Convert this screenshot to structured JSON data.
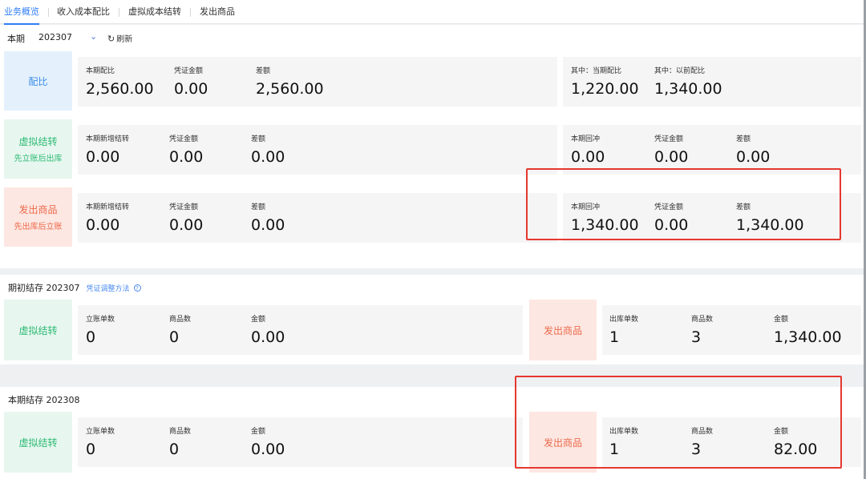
{
  "tabs": [
    "业务概览",
    "收入成本配比",
    "虚拟成本结转",
    "发出商品"
  ],
  "period": {
    "label": "本期",
    "value": "202307",
    "refresh": "刷新"
  },
  "rows": {
    "match": {
      "tag": "配比",
      "left": [
        {
          "label": "本期配比",
          "value": "2,560.00"
        },
        {
          "label": "凭证金额",
          "value": "0.00"
        },
        {
          "label": "差额",
          "value": "2,560.00"
        }
      ],
      "right": [
        {
          "label": "其中：当期配比",
          "value": "1,220.00"
        },
        {
          "label": "其中：以前配比",
          "value": "1,340.00"
        }
      ]
    },
    "virtual": {
      "tag": "虚拟结转",
      "sub": "先立账后出库",
      "left": [
        {
          "label": "本期新增结转",
          "value": "0.00"
        },
        {
          "label": "凭证金额",
          "value": "0.00"
        },
        {
          "label": "差额",
          "value": "0.00"
        }
      ],
      "right": [
        {
          "label": "本期回冲",
          "value": "0.00"
        },
        {
          "label": "凭证金额",
          "value": "0.00"
        },
        {
          "label": "差额",
          "value": "0.00"
        }
      ]
    },
    "shipped": {
      "tag": "发出商品",
      "sub": "先出库后立账",
      "left": [
        {
          "label": "本期新增结转",
          "value": "0.00"
        },
        {
          "label": "凭证金额",
          "value": "0.00"
        },
        {
          "label": "差额",
          "value": "0.00"
        }
      ],
      "right": [
        {
          "label": "本期回冲",
          "value": "1,340.00"
        },
        {
          "label": "凭证金额",
          "value": "0.00"
        },
        {
          "label": "差额",
          "value": "1,340.00"
        }
      ]
    }
  },
  "opening": {
    "title": "期初结存",
    "period": "202307",
    "link": "凭证调整方法",
    "help": "?",
    "virtual": {
      "tag": "虚拟结转",
      "metrics": [
        {
          "label": "立账单数",
          "value": "0"
        },
        {
          "label": "商品数",
          "value": "0"
        },
        {
          "label": "金额",
          "value": "0.00"
        }
      ]
    },
    "shipped": {
      "tag": "发出商品",
      "metrics": [
        {
          "label": "出库单数",
          "value": "1"
        },
        {
          "label": "商品数",
          "value": "3"
        },
        {
          "label": "金额",
          "value": "1,340.00"
        }
      ]
    }
  },
  "closing": {
    "title": "本期结存",
    "period": "202308",
    "virtual": {
      "tag": "虚拟结转",
      "metrics": [
        {
          "label": "立账单数",
          "value": "0"
        },
        {
          "label": "商品数",
          "value": "0"
        },
        {
          "label": "金额",
          "value": "0.00"
        }
      ]
    },
    "shipped": {
      "tag": "发出商品",
      "metrics": [
        {
          "label": "出库单数",
          "value": "1"
        },
        {
          "label": "商品数",
          "value": "3"
        },
        {
          "label": "金额",
          "value": "82.00"
        }
      ]
    }
  },
  "colors": {
    "accent": "#2f7df6",
    "highlight": "#e5382f",
    "blue_tag": "#3b8ee8",
    "green_tag": "#2fba76",
    "orange_tag": "#ec6a4a"
  }
}
